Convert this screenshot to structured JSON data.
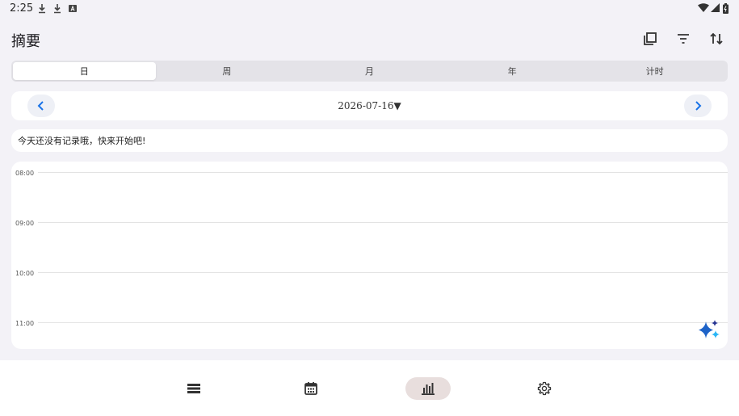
{
  "status_bar": {
    "time": "2:25",
    "left_icons": [
      "download-icon",
      "download-icon",
      "a-box-icon"
    ],
    "right_icons": [
      "wifi-icon",
      "signal-icon",
      "battery-icon"
    ]
  },
  "app_bar": {
    "title": "摘要",
    "actions": [
      "copy-layers-icon",
      "filter-icon",
      "sort-icon"
    ]
  },
  "tabs": [
    {
      "label": "日",
      "active": true
    },
    {
      "label": "周",
      "active": false
    },
    {
      "label": "月",
      "active": false
    },
    {
      "label": "年",
      "active": false
    },
    {
      "label": "计时",
      "active": false
    }
  ],
  "date_nav": {
    "date": "2026-07-16▼",
    "prev_icon": "chevron-left-icon",
    "next_icon": "chevron-right-icon"
  },
  "empty_message": "今天还没有记录哦，快来开始吧!",
  "timeline": {
    "hours": [
      "08:00",
      "09:00",
      "10:00",
      "11:00"
    ]
  },
  "fab_icon": "sparkle-icon",
  "bottom_nav": {
    "items": [
      {
        "icon": "list-icon",
        "active": false
      },
      {
        "icon": "calendar-icon",
        "active": false
      },
      {
        "icon": "bar-chart-icon",
        "active": true
      },
      {
        "icon": "gear-icon",
        "active": false
      }
    ]
  },
  "colors": {
    "background": "#f3f2f7",
    "card": "#ffffff",
    "accent_blue": "#1a73e8",
    "active_nav_pill": "#e8dedd",
    "sparkle_dark": "#283593",
    "sparkle_light": "#29b6f6"
  }
}
